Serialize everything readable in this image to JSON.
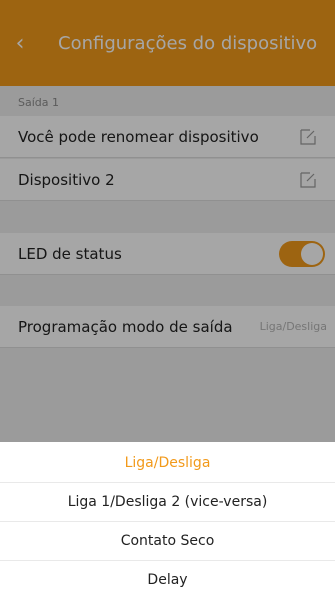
{
  "header": {
    "title": "Configurações do dispositivo",
    "back_icon": "chevron-left-icon"
  },
  "section": {
    "label": "Saída 1"
  },
  "rows": {
    "rename_device": "Você pode renomear dispositivo",
    "device_name": "Dispositivo 2",
    "led_status": "LED de status",
    "output_mode": "Programação modo de saída",
    "output_mode_value": "Liga/Desliga"
  },
  "led_toggle": {
    "state": "on"
  },
  "sheet": {
    "options": [
      {
        "label": "Liga/Desliga",
        "selected": true
      },
      {
        "label": "Liga 1/Desliga 2 (vice-versa)",
        "selected": false
      },
      {
        "label": "Contato Seco",
        "selected": false
      },
      {
        "label": "Delay",
        "selected": false
      }
    ]
  },
  "colors": {
    "accent": "#f29a1b",
    "background": "#efefef",
    "text": "#222222",
    "muted_text": "#8c8c8c"
  }
}
